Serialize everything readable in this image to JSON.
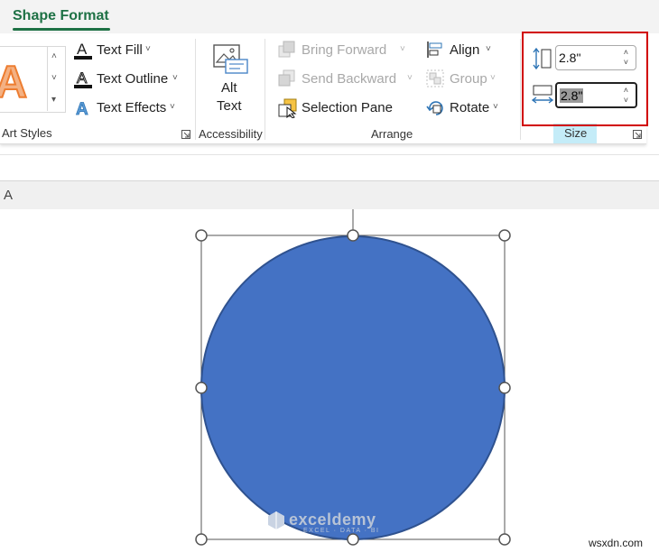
{
  "tab": {
    "label": "Shape Format"
  },
  "text_group": {
    "fill_label": "Text Fill",
    "outline_label": "Text Outline",
    "effects_label": "Text Effects",
    "group_label": "Art Styles",
    "sample_letter": "A"
  },
  "accessibility": {
    "alt_line1": "Alt",
    "alt_line2": "Text",
    "group_label": "Accessibility"
  },
  "arrange": {
    "bring_forward": "Bring Forward",
    "send_backward": "Send Backward",
    "selection_pane": "Selection Pane",
    "align": "Align",
    "group": "Group",
    "rotate": "Rotate",
    "group_label": "Arrange"
  },
  "size": {
    "height_value": "2.8\"",
    "width_value": "2.8\"",
    "group_label": "Size"
  },
  "sheet": {
    "column_a": "A"
  },
  "shape": {
    "fill_color": "#4472c4",
    "outline_color": "#2f528f"
  },
  "watermark": {
    "brand": "exceldemy",
    "tagline": "EXCEL · DATA · BI"
  },
  "credit": "wsxdn.com",
  "colors": {
    "tab_accent": "#1e7145",
    "highlight": "#d10000",
    "size_label_bg": "#c4ecf8"
  }
}
